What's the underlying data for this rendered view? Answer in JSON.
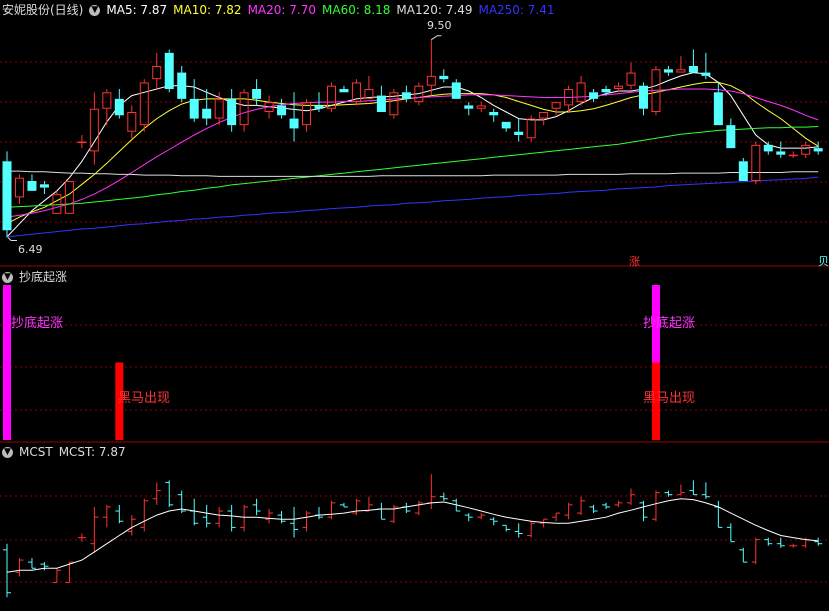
{
  "header": {
    "stock_name": "安妮股份(日线)",
    "ma": [
      {
        "label": "MA5: 7.87",
        "color": "#ffffff"
      },
      {
        "label": "MA10: 7.82",
        "color": "#ffff33"
      },
      {
        "label": "MA20: 7.70",
        "color": "#ff33ff"
      },
      {
        "label": "MA60: 8.18",
        "color": "#33ff33"
      },
      {
        "label": "MA120: 7.49",
        "color": "#dddddd"
      },
      {
        "label": "MA250: 7.41",
        "color": "#3333ff"
      }
    ]
  },
  "indicator_panel": {
    "title": "抄底起涨",
    "signal_labels": [
      "抄底起涨",
      "黑马出现",
      "抄底起涨",
      "黑马出现"
    ]
  },
  "mcst_panel": {
    "title": "MCST",
    "value_label": "MCST: 7.87"
  },
  "price_markers": {
    "high": "9.50",
    "low": "6.49"
  },
  "bottom_markers": [
    "涨",
    "贝"
  ],
  "colors": {
    "up": "#ff3232",
    "down": "#54ffff",
    "grid": "#8b0000",
    "divider": "#a00000"
  },
  "chart_data": [
    {
      "type": "candlestick",
      "title": "安妮股份(日线)",
      "ylim": [
        6.3,
        9.8
      ],
      "ohlc": [
        [
          7.65,
          7.8,
          6.49,
          6.6
        ],
        [
          7.1,
          7.45,
          7.0,
          7.4
        ],
        [
          7.35,
          7.45,
          7.2,
          7.2
        ],
        [
          7.3,
          7.35,
          7.15,
          7.25
        ],
        [
          6.85,
          7.2,
          6.85,
          7.15
        ],
        [
          6.85,
          7.35,
          6.85,
          7.35
        ],
        [
          7.95,
          8.05,
          7.85,
          7.95
        ],
        [
          7.8,
          8.7,
          7.6,
          8.45
        ],
        [
          8.45,
          8.75,
          8.2,
          8.7
        ],
        [
          8.6,
          8.75,
          8.3,
          8.35
        ],
        [
          8.1,
          8.5,
          8.0,
          8.4
        ],
        [
          8.2,
          8.9,
          8.1,
          8.85
        ],
        [
          8.9,
          9.3,
          8.75,
          9.1
        ],
        [
          9.3,
          9.35,
          8.7,
          8.75
        ],
        [
          9.0,
          9.1,
          8.55,
          8.6
        ],
        [
          8.6,
          8.9,
          8.25,
          8.3
        ],
        [
          8.45,
          8.75,
          8.2,
          8.3
        ],
        [
          8.3,
          8.7,
          8.2,
          8.6
        ],
        [
          8.6,
          8.75,
          8.1,
          8.2
        ],
        [
          8.2,
          8.75,
          8.1,
          8.7
        ],
        [
          8.75,
          8.9,
          8.5,
          8.6
        ],
        [
          8.4,
          8.65,
          8.3,
          8.55
        ],
        [
          8.5,
          8.6,
          8.3,
          8.35
        ],
        [
          8.3,
          8.7,
          7.95,
          8.15
        ],
        [
          8.2,
          8.6,
          8.1,
          8.55
        ],
        [
          8.5,
          8.7,
          8.4,
          8.45
        ],
        [
          8.45,
          8.85,
          8.4,
          8.8
        ],
        [
          8.75,
          8.8,
          8.7,
          8.7
        ],
        [
          8.55,
          8.9,
          8.5,
          8.85
        ],
        [
          8.6,
          8.95,
          8.6,
          8.75
        ],
        [
          8.65,
          8.8,
          8.4,
          8.4
        ],
        [
          8.35,
          8.75,
          8.3,
          8.7
        ],
        [
          8.7,
          8.8,
          8.55,
          8.6
        ],
        [
          8.55,
          8.85,
          8.5,
          8.8
        ],
        [
          8.8,
          9.5,
          8.65,
          8.95
        ],
        [
          8.95,
          9.05,
          8.85,
          8.9
        ],
        [
          8.85,
          8.9,
          8.6,
          8.6
        ],
        [
          8.5,
          8.55,
          8.35,
          8.45
        ],
        [
          8.45,
          8.55,
          8.4,
          8.5
        ],
        [
          8.4,
          8.45,
          8.25,
          8.35
        ],
        [
          8.25,
          8.25,
          8.1,
          8.15
        ],
        [
          8.1,
          8.3,
          7.95,
          8.05
        ],
        [
          8.0,
          8.35,
          7.95,
          8.3
        ],
        [
          8.3,
          8.4,
          8.2,
          8.4
        ],
        [
          8.45,
          8.55,
          8.35,
          8.55
        ],
        [
          8.5,
          8.8,
          8.4,
          8.75
        ],
        [
          8.55,
          8.95,
          8.5,
          8.85
        ],
        [
          8.7,
          8.75,
          8.55,
          8.6
        ],
        [
          8.75,
          8.8,
          8.65,
          8.7
        ],
        [
          8.75,
          8.85,
          8.7,
          8.8
        ],
        [
          8.8,
          9.15,
          8.75,
          9.0
        ],
        [
          8.8,
          8.85,
          8.35,
          8.45
        ],
        [
          8.4,
          9.1,
          8.35,
          9.05
        ],
        [
          9.05,
          9.1,
          8.95,
          9.0
        ],
        [
          9.0,
          9.25,
          9.0,
          9.05
        ],
        [
          9.1,
          9.35,
          9.0,
          9.0
        ],
        [
          9.0,
          9.3,
          8.9,
          8.95
        ],
        [
          8.7,
          8.85,
          8.2,
          8.2
        ],
        [
          8.2,
          8.3,
          7.85,
          7.85
        ],
        [
          7.65,
          7.7,
          7.35,
          7.35
        ],
        [
          7.35,
          7.95,
          7.3,
          7.9
        ],
        [
          7.9,
          7.95,
          7.75,
          7.8
        ],
        [
          7.8,
          7.95,
          7.7,
          7.75
        ],
        [
          7.75,
          7.8,
          7.7,
          7.75
        ],
        [
          7.75,
          7.95,
          7.7,
          7.9
        ],
        [
          7.85,
          7.95,
          7.75,
          7.8
        ]
      ],
      "ma_series": [
        {
          "name": "MA5",
          "color": "#ffffff",
          "values": [
            6.5,
            6.7,
            6.9,
            7.05,
            7.2,
            7.4,
            7.65,
            7.95,
            8.25,
            8.5,
            8.65,
            8.7,
            8.75,
            8.8,
            8.8,
            8.78,
            8.7,
            8.62,
            8.55,
            8.5,
            8.5,
            8.48,
            8.46,
            8.44,
            8.42,
            8.45,
            8.5,
            8.55,
            8.6,
            8.62,
            8.63,
            8.64,
            8.66,
            8.68,
            8.73,
            8.78,
            8.78,
            8.72,
            8.62,
            8.5,
            8.4,
            8.3,
            8.28,
            8.28,
            8.33,
            8.42,
            8.53,
            8.62,
            8.68,
            8.72,
            8.72,
            8.75,
            8.8,
            8.88,
            8.95,
            9.0,
            8.98,
            8.85,
            8.65,
            8.35,
            8.05,
            7.9,
            7.85,
            7.85,
            7.85,
            7.87
          ]
        },
        {
          "name": "MA10",
          "color": "#ffff33",
          "values": [
            6.7,
            6.8,
            6.88,
            6.95,
            7.05,
            7.15,
            7.3,
            7.45,
            7.62,
            7.8,
            7.98,
            8.15,
            8.3,
            8.42,
            8.52,
            8.58,
            8.6,
            8.6,
            8.6,
            8.6,
            8.58,
            8.55,
            8.53,
            8.51,
            8.5,
            8.5,
            8.5,
            8.51,
            8.52,
            8.53,
            8.55,
            8.57,
            8.6,
            8.62,
            8.65,
            8.67,
            8.68,
            8.68,
            8.68,
            8.66,
            8.62,
            8.56,
            8.5,
            8.44,
            8.4,
            8.4,
            8.42,
            8.45,
            8.5,
            8.56,
            8.62,
            8.66,
            8.7,
            8.74,
            8.78,
            8.82,
            8.85,
            8.85,
            8.8,
            8.7,
            8.55,
            8.42,
            8.3,
            8.15,
            8.0,
            7.88
          ]
        },
        {
          "name": "MA20",
          "color": "#ff33ff",
          "values": [
            6.8,
            6.83,
            6.86,
            6.9,
            6.95,
            7.0,
            7.07,
            7.15,
            7.25,
            7.36,
            7.48,
            7.6,
            7.72,
            7.83,
            7.94,
            8.05,
            8.15,
            8.24,
            8.32,
            8.39,
            8.44,
            8.48,
            8.51,
            8.53,
            8.54,
            8.55,
            8.55,
            8.56,
            8.56,
            8.57,
            8.58,
            8.6,
            8.61,
            8.62,
            8.63,
            8.64,
            8.65,
            8.66,
            8.66,
            8.66,
            8.65,
            8.64,
            8.63,
            8.62,
            8.62,
            8.62,
            8.63,
            8.64,
            8.66,
            8.68,
            8.7,
            8.72,
            8.73,
            8.74,
            8.75,
            8.75,
            8.75,
            8.74,
            8.72,
            8.68,
            8.62,
            8.56,
            8.5,
            8.43,
            8.35,
            8.28
          ]
        },
        {
          "name": "MA60",
          "color": "#33ff33",
          "values": [
            6.95,
            6.96,
            6.97,
            6.98,
            6.99,
            7.0,
            7.01,
            7.03,
            7.05,
            7.07,
            7.09,
            7.11,
            7.14,
            7.16,
            7.19,
            7.21,
            7.24,
            7.26,
            7.29,
            7.31,
            7.33,
            7.35,
            7.37,
            7.39,
            7.41,
            7.43,
            7.45,
            7.47,
            7.49,
            7.51,
            7.53,
            7.55,
            7.57,
            7.59,
            7.61,
            7.63,
            7.65,
            7.67,
            7.69,
            7.71,
            7.73,
            7.75,
            7.77,
            7.79,
            7.81,
            7.83,
            7.85,
            7.87,
            7.89,
            7.91,
            7.94,
            7.97,
            8.0,
            8.03,
            8.06,
            8.08,
            8.1,
            8.12,
            8.13,
            8.14,
            8.15,
            8.16,
            8.16,
            8.17,
            8.17,
            8.18
          ]
        },
        {
          "name": "MA120",
          "color": "#dddddd",
          "values": [
            7.5,
            7.5,
            7.49,
            7.49,
            7.48,
            7.47,
            7.47,
            7.46,
            7.46,
            7.45,
            7.45,
            7.44,
            7.44,
            7.44,
            7.43,
            7.43,
            7.43,
            7.42,
            7.42,
            7.42,
            7.42,
            7.42,
            7.42,
            7.42,
            7.42,
            7.42,
            7.42,
            7.42,
            7.42,
            7.42,
            7.43,
            7.43,
            7.43,
            7.43,
            7.43,
            7.43,
            7.43,
            7.43,
            7.43,
            7.44,
            7.44,
            7.44,
            7.44,
            7.44,
            7.44,
            7.45,
            7.45,
            7.45,
            7.45,
            7.45,
            7.46,
            7.46,
            7.46,
            7.46,
            7.47,
            7.47,
            7.47,
            7.47,
            7.48,
            7.48,
            7.48,
            7.48,
            7.48,
            7.49,
            7.49,
            7.49
          ]
        },
        {
          "name": "MA250",
          "color": "#3333ff",
          "values": [
            6.5,
            6.52,
            6.54,
            6.56,
            6.58,
            6.6,
            6.62,
            6.63,
            6.65,
            6.67,
            6.69,
            6.7,
            6.72,
            6.74,
            6.75,
            6.77,
            6.78,
            6.8,
            6.81,
            6.83,
            6.84,
            6.86,
            6.87,
            6.88,
            6.9,
            6.91,
            6.93,
            6.94,
            6.95,
            6.97,
            6.98,
            6.99,
            7.01,
            7.02,
            7.03,
            7.05,
            7.06,
            7.07,
            7.09,
            7.1,
            7.11,
            7.13,
            7.14,
            7.15,
            7.16,
            7.18,
            7.19,
            7.2,
            7.21,
            7.23,
            7.24,
            7.25,
            7.26,
            7.28,
            7.29,
            7.3,
            7.31,
            7.32,
            7.33,
            7.34,
            7.35,
            7.36,
            7.37,
            7.38,
            7.39,
            7.41
          ]
        }
      ]
    },
    {
      "type": "bar",
      "title": "抄底起涨",
      "signals": [
        {
          "index": 0,
          "name": "抄底起涨",
          "color": "#ff00ff",
          "level": 1.0
        },
        {
          "index": 9,
          "name": "黑马出现",
          "color": "#ff0000",
          "level": 0.5
        },
        {
          "index": 52,
          "name": "抄底起涨",
          "color": "#ff00ff",
          "level": 1.0
        },
        {
          "index": 52,
          "name": "黑马出现",
          "color": "#ff0000",
          "level": 0.5
        }
      ]
    },
    {
      "type": "line",
      "title": "MCST",
      "ylim": [
        6.3,
        9.8
      ],
      "series": [
        {
          "name": "MCST",
          "color": "#ffffff",
          "values": [
            7.1,
            7.15,
            7.15,
            7.2,
            7.2,
            7.3,
            7.4,
            7.6,
            7.8,
            8.0,
            8.2,
            8.35,
            8.5,
            8.6,
            8.65,
            8.6,
            8.55,
            8.5,
            8.48,
            8.45,
            8.45,
            8.42,
            8.4,
            8.4,
            8.45,
            8.5,
            8.52,
            8.55,
            8.6,
            8.62,
            8.65,
            8.65,
            8.7,
            8.75,
            8.8,
            8.82,
            8.75,
            8.68,
            8.6,
            8.52,
            8.45,
            8.4,
            8.35,
            8.32,
            8.3,
            8.3,
            8.35,
            8.4,
            8.45,
            8.55,
            8.62,
            8.7,
            8.78,
            8.85,
            8.9,
            8.88,
            8.8,
            8.7,
            8.55,
            8.4,
            8.25,
            8.12,
            8.0,
            7.95,
            7.9,
            7.87
          ]
        }
      ]
    }
  ]
}
